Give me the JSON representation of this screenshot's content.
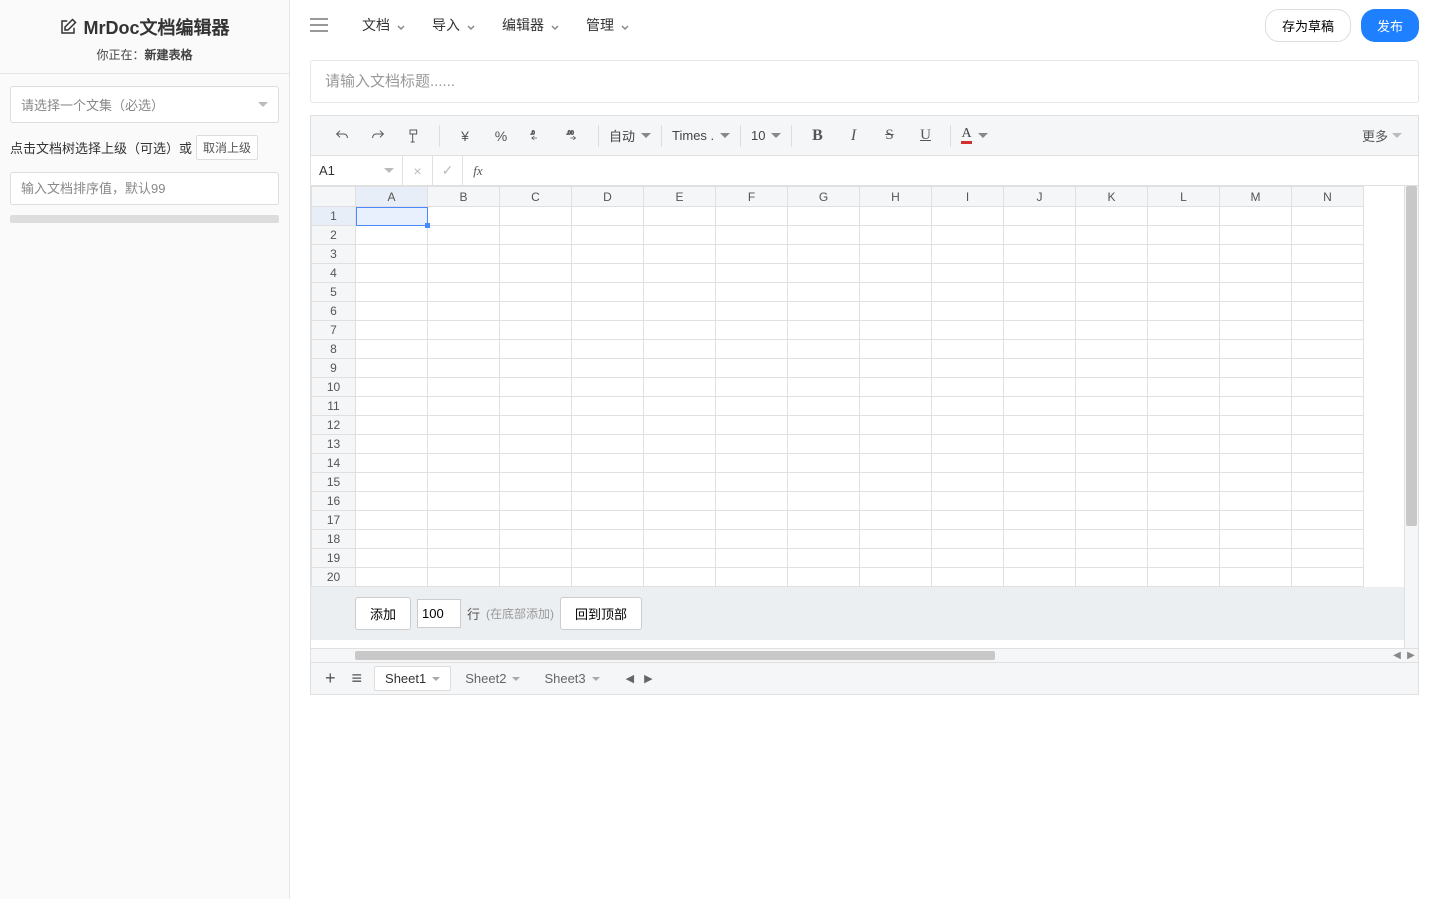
{
  "sidebar": {
    "app_title": "MrDoc文档编辑器",
    "location_prefix": "你正在：",
    "location_value": "新建表格",
    "select_placeholder": "请选择一个文集（必选）",
    "parent_label": "点击文档树选择上级（可选）或",
    "cancel_parent": "取消上级",
    "sort_placeholder": "输入文档排序值，默认99"
  },
  "topbar": {
    "menu": {
      "doc": "文档",
      "import": "导入",
      "editor": "编辑器",
      "manage": "管理"
    },
    "save_draft": "存为草稿",
    "publish": "发布"
  },
  "title_placeholder": "请输入文档标题......",
  "toolbar": {
    "currency": "¥",
    "percent": "%",
    "auto_format": "自动",
    "font_name": "Times ...",
    "font_size": "10",
    "bold": "B",
    "italic": "I",
    "strike": "S",
    "underline": "U",
    "color_letter": "A",
    "more": "更多"
  },
  "formula": {
    "cell_ref": "A1",
    "cancel": "×",
    "confirm": "✓",
    "fx": "fx"
  },
  "grid": {
    "columns": [
      "A",
      "B",
      "C",
      "D",
      "E",
      "F",
      "G",
      "H",
      "I",
      "J",
      "K",
      "L",
      "M",
      "N"
    ],
    "rows": 20,
    "selected": {
      "row": 0,
      "col": 0
    }
  },
  "addrow": {
    "add_btn": "添加",
    "count": "100",
    "rows_label": "行",
    "hint": "(在底部添加)",
    "top_btn": "回到顶部"
  },
  "tabs": {
    "sheets": [
      "Sheet1",
      "Sheet2",
      "Sheet3"
    ],
    "active": 0
  }
}
